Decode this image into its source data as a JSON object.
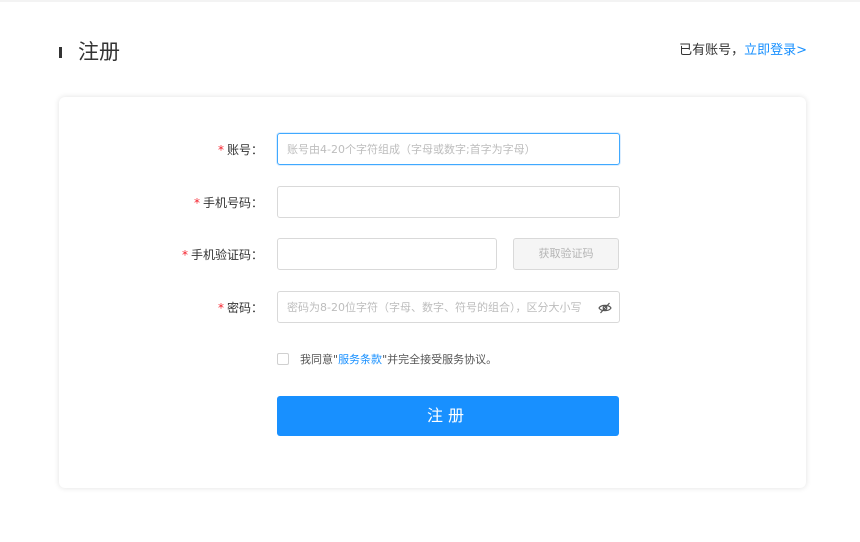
{
  "header": {
    "title": "注册",
    "login_prompt": "已有账号，",
    "login_link": "立即登录>"
  },
  "form": {
    "account": {
      "required_mark": "*",
      "label": "账号：",
      "placeholder": "账号由4-20个字符组成（字母或数字;首字为字母）",
      "value": ""
    },
    "phone": {
      "required_mark": "*",
      "label": "手机号码：",
      "placeholder": "",
      "value": ""
    },
    "sms_code": {
      "required_mark": "*",
      "label": "手机验证码：",
      "placeholder": "",
      "value": "",
      "button_label": "获取验证码"
    },
    "password": {
      "required_mark": "*",
      "label": "密码：",
      "placeholder": "密码为8-20位字符（字母、数字、符号的组合），区分大小写",
      "value": "",
      "toggle_icon": "eye-off-icon"
    },
    "agreement": {
      "checked": false,
      "prefix": "我同意\"",
      "terms_link": "服务条款",
      "suffix": "\"并完全接受服务协议。"
    },
    "submit_label": "注册"
  },
  "colors": {
    "primary": "#1890ff",
    "required": "#f5222d",
    "disabled_bg": "#f5f5f5"
  }
}
